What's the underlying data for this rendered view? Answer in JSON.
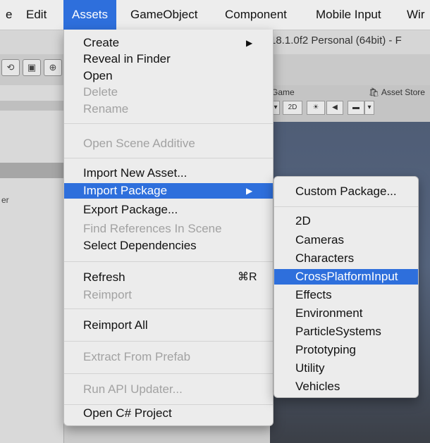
{
  "menubar": {
    "items": [
      "e",
      "Edit",
      "Assets",
      "GameObject",
      "Component",
      "Mobile Input",
      "Wir"
    ],
    "active_index": 2
  },
  "window": {
    "title": "18.1.0f2 Personal (64bit) - F",
    "tabs": {
      "game": "Game",
      "asset_store": "Asset Store"
    },
    "game_ctrl_2d": "2D",
    "left_panel_text": "er"
  },
  "assets_menu": {
    "create": "Create",
    "reveal_in_finder": "Reveal in Finder",
    "open": "Open",
    "delete": "Delete",
    "rename": "Rename",
    "open_scene_additive": "Open Scene Additive",
    "import_new_asset": "Import New Asset...",
    "import_package": "Import Package",
    "export_package": "Export Package...",
    "find_references": "Find References In Scene",
    "select_dependencies": "Select Dependencies",
    "refresh": "Refresh",
    "refresh_shortcut": "⌘R",
    "reimport": "Reimport",
    "reimport_all": "Reimport All",
    "extract_from_prefab": "Extract From Prefab",
    "run_api_updater": "Run API Updater...",
    "open_csharp_project": "Open C# Project",
    "submenu_arrow": "▶"
  },
  "import_package_submenu": {
    "custom_package": "Custom Package...",
    "items": [
      "2D",
      "Cameras",
      "Characters",
      "CrossPlatformInput",
      "Effects",
      "Environment",
      "ParticleSystems",
      "Prototyping",
      "Utility",
      "Vehicles"
    ],
    "highlighted": "CrossPlatformInput"
  },
  "colors": {
    "highlight": "#2e6fdc",
    "menu_bg": "#ececec",
    "disabled_text": "#a2a2a2",
    "scene_sky": "#4f5d76"
  }
}
